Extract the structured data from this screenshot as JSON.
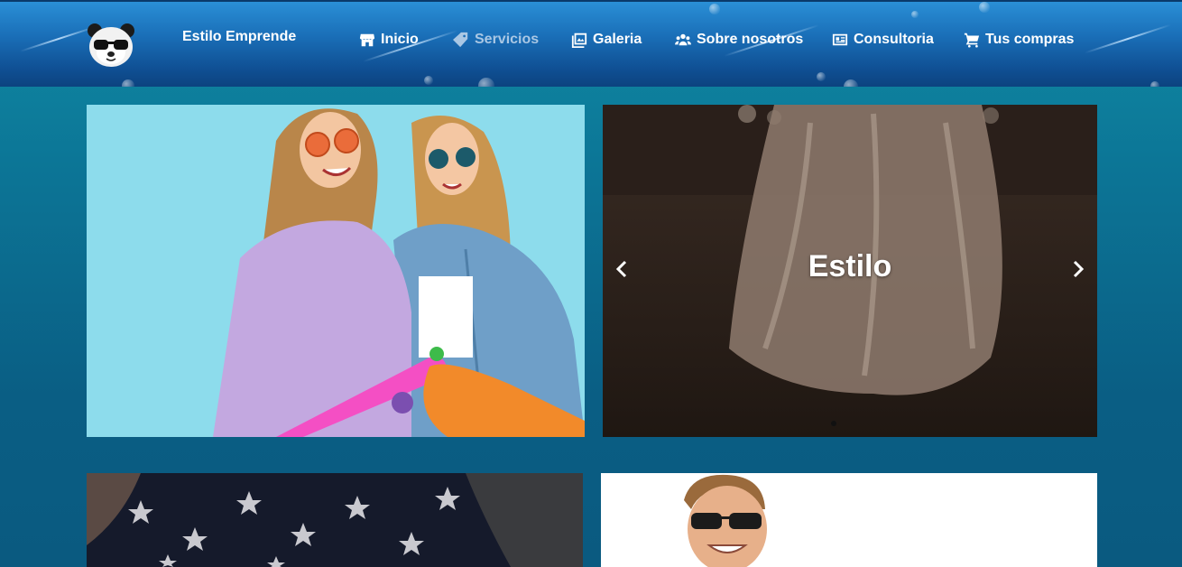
{
  "header": {
    "brand": "Estilo Emprende",
    "logo": "panda-sunglasses-logo",
    "nav": [
      {
        "label": "Inicio",
        "icon": "store-icon",
        "active": false
      },
      {
        "label": "Servicios",
        "icon": "tag-icon",
        "active": true
      },
      {
        "label": "Galeria",
        "icon": "gallery-icon",
        "active": false
      },
      {
        "label": "Sobre nosotros",
        "icon": "users-icon",
        "active": false
      },
      {
        "label": "Consultoria",
        "icon": "id-card-icon",
        "active": false
      },
      {
        "label": "Tus compras",
        "icon": "cart-icon",
        "active": false
      }
    ]
  },
  "carousel": {
    "caption": "Estilo",
    "prev_icon": "chevron-left-icon",
    "next_icon": "chevron-right-icon"
  },
  "colors": {
    "header_top": "#2a8fd6",
    "header_bottom": "#0c437f",
    "page_bg_top": "#0f8aa4",
    "page_bg_bottom": "#0a5a80",
    "nav_active": "#a9c7e4"
  }
}
